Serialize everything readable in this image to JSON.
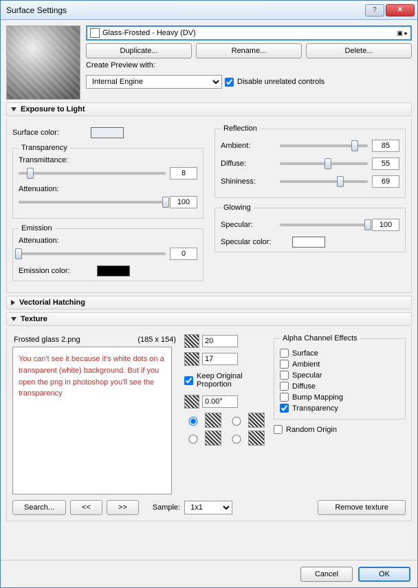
{
  "window": {
    "title": "Surface Settings"
  },
  "material": {
    "name": "Glass-Frosted - Heavy (DV)"
  },
  "buttons": {
    "duplicate": "Duplicate...",
    "rename": "Rename...",
    "delete": "Delete..."
  },
  "preview": {
    "label": "Create Preview with:",
    "engine": "Internal Engine",
    "disable_unrelated": "Disable unrelated controls"
  },
  "sections": {
    "exposure": "Exposure to Light",
    "vectorial": "Vectorial Hatching",
    "texture": "Texture"
  },
  "exposure": {
    "surface_color_label": "Surface color:",
    "transparency": {
      "legend": "Transparency",
      "transmittance_label": "Transmittance:",
      "transmittance": "8",
      "attenuation_label": "Attenuation:",
      "attenuation": "100"
    },
    "emission": {
      "legend": "Emission",
      "attenuation_label": "Attenuation:",
      "attenuation": "0",
      "color_label": "Emission color:"
    },
    "reflection": {
      "legend": "Reflection",
      "ambient_label": "Ambient:",
      "ambient": "85",
      "diffuse_label": "Diffuse:",
      "diffuse": "55",
      "shininess_label": "Shininess:",
      "shininess": "69"
    },
    "glowing": {
      "legend": "Glowing",
      "specular_label": "Specular:",
      "specular": "100",
      "color_label": "Specular color:"
    }
  },
  "texture": {
    "filename": "Frosted glass 2.png",
    "dims": "(185 x 154)",
    "note": "You can't see it because it's white dots on a transparent (white) background. But if you open the png in photoshop you'll see the transparency",
    "width": "20",
    "height": "17",
    "keep_proportion": "Keep Original Proportion",
    "angle": "0.00°",
    "search": "Search...",
    "prev": "<<",
    "next": ">>",
    "sample_label": "Sample:",
    "sample": "1x1",
    "remove": "Remove texture",
    "alpha": {
      "legend": "Alpha Channel Effects",
      "surface": "Surface",
      "ambient": "Ambient",
      "specular": "Specular",
      "diffuse": "Diffuse",
      "bump": "Bump Mapping",
      "transparency": "Transparency"
    },
    "random_origin": "Random Origin"
  },
  "footer": {
    "cancel": "Cancel",
    "ok": "OK"
  }
}
